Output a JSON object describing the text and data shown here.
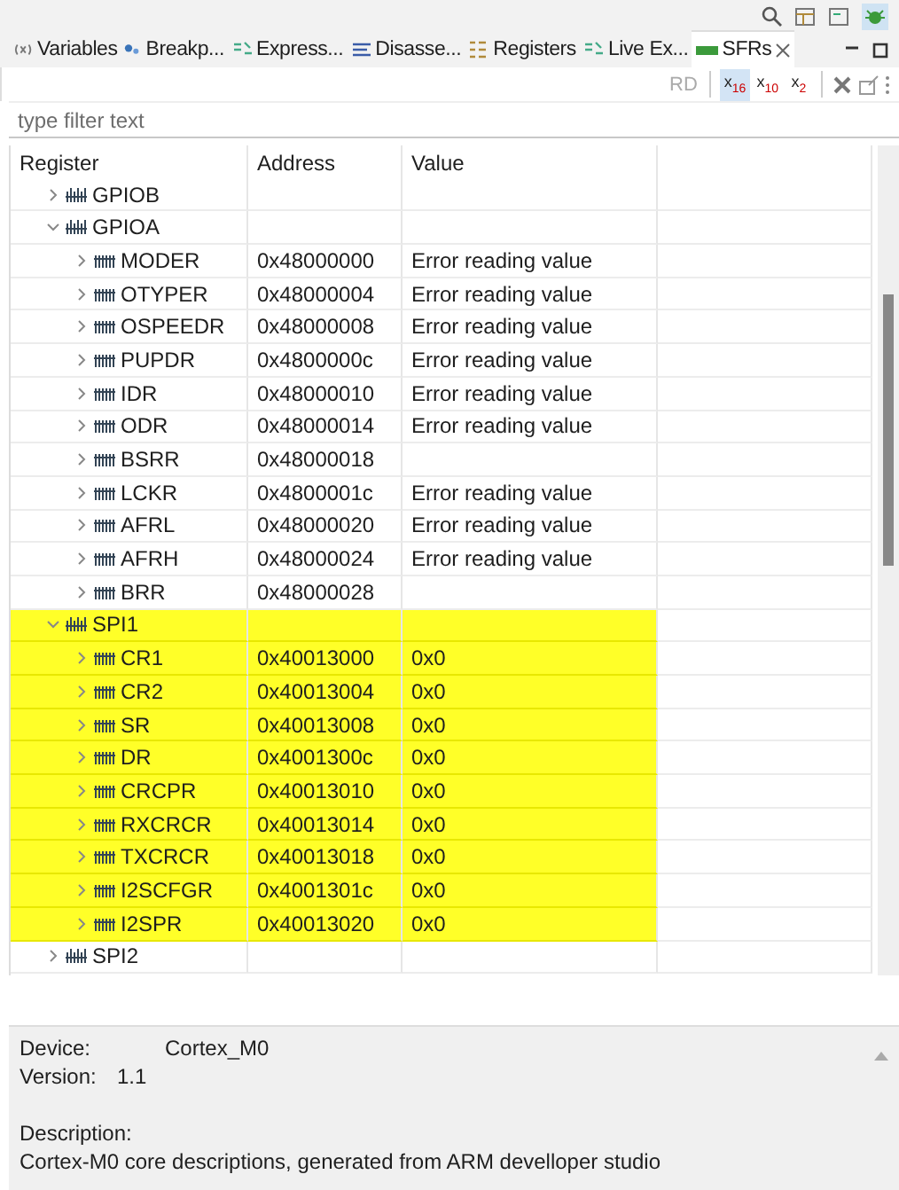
{
  "tabs": [
    {
      "label": "Variables",
      "selected": false
    },
    {
      "label": "Breakp...",
      "selected": false
    },
    {
      "label": "Express...",
      "selected": false
    },
    {
      "label": "Disasse...",
      "selected": false
    },
    {
      "label": "Registers",
      "selected": false
    },
    {
      "label": "Live Ex...",
      "selected": false
    },
    {
      "label": "SFRs",
      "selected": true
    }
  ],
  "toolbar": [
    {
      "kind": "text",
      "label": "RD",
      "disabled": true,
      "selected": false
    },
    {
      "kind": "format",
      "label": "x$_{16}$",
      "disabled": false,
      "selected": true
    },
    {
      "kind": "format",
      "label": "x$_{10}$",
      "disabled": false,
      "selected": false
    },
    {
      "kind": "format",
      "label": "x$_{2}$",
      "disabled": false,
      "selected": false
    }
  ],
  "filter": {
    "placeholder": "type filter text"
  },
  "table": {
    "columns": [
      "Register",
      "Address",
      "Value"
    ],
    "rows": [
      {
        "kind": "peripheral",
        "name": "GPIOB",
        "expanded": false,
        "highlighted": false
      },
      {
        "kind": "peripheral",
        "name": "GPIOA",
        "expanded": true,
        "highlighted": false,
        "children": [
          {
            "kind": "register",
            "name": "MODER",
            "address": "0x48000000",
            "value": "Error reading value",
            "expanded": false,
            "highlighted": false
          },
          {
            "kind": "register",
            "name": "OTYPER",
            "address": "0x48000004",
            "value": "Error reading value",
            "expanded": false,
            "highlighted": false
          },
          {
            "kind": "register",
            "name": "OSPEEDR",
            "address": "0x48000008",
            "value": "Error reading value",
            "expanded": false,
            "highlighted": false
          },
          {
            "kind": "register",
            "name": "PUPDR",
            "address": "0x4800000c",
            "value": "Error reading value",
            "expanded": false,
            "highlighted": false
          },
          {
            "kind": "register",
            "name": "IDR",
            "address": "0x48000010",
            "value": "Error reading value",
            "expanded": false,
            "highlighted": false
          },
          {
            "kind": "register",
            "name": "ODR",
            "address": "0x48000014",
            "value": "Error reading value",
            "expanded": false,
            "highlighted": false
          },
          {
            "kind": "register",
            "name": "BSRR",
            "address": "0x48000018",
            "expanded": false,
            "highlighted": false
          },
          {
            "kind": "register",
            "name": "LCKR",
            "address": "0x4800001c",
            "value": "Error reading value",
            "expanded": false,
            "highlighted": false
          },
          {
            "kind": "register",
            "name": "AFRL",
            "address": "0x48000020",
            "value": "Error reading value",
            "expanded": false,
            "highlighted": false
          },
          {
            "kind": "register",
            "name": "AFRH",
            "address": "0x48000024",
            "value": "Error reading value",
            "expanded": false,
            "highlighted": false
          },
          {
            "kind": "register",
            "name": "BRR",
            "address": "0x48000028",
            "expanded": false,
            "highlighted": false
          }
        ]
      },
      {
        "kind": "peripheral",
        "name": "SPI1",
        "expanded": true,
        "highlighted": true,
        "children": [
          {
            "kind": "register",
            "name": "CR1",
            "address": "0x40013000",
            "value": "0x0",
            "expanded": false,
            "highlighted": true
          },
          {
            "kind": "register",
            "name": "CR2",
            "address": "0x40013004",
            "value": "0x0",
            "expanded": false,
            "highlighted": true
          },
          {
            "kind": "register",
            "name": "SR",
            "address": "0x40013008",
            "value": "0x0",
            "expanded": false,
            "highlighted": true
          },
          {
            "kind": "register",
            "name": "DR",
            "address": "0x4001300c",
            "value": "0x0",
            "expanded": false,
            "highlighted": true
          },
          {
            "kind": "register",
            "name": "CRCPR",
            "address": "0x40013010",
            "value": "0x0",
            "expanded": false,
            "highlighted": true
          },
          {
            "kind": "register",
            "name": "RXCRCR",
            "address": "0x40013014",
            "value": "0x0",
            "expanded": false,
            "highlighted": true
          },
          {
            "kind": "register",
            "name": "TXCRCR",
            "address": "0x40013018",
            "value": "0x0",
            "expanded": false,
            "highlighted": true
          },
          {
            "kind": "register",
            "name": "I2SCFGR",
            "address": "0x4001301c",
            "value": "0x0",
            "expanded": false,
            "highlighted": true
          },
          {
            "kind": "register",
            "name": "I2SPR",
            "address": "0x40013020",
            "value": "0x0",
            "expanded": false,
            "highlighted": true
          }
        ]
      },
      {
        "kind": "peripheral",
        "name": "SPI2",
        "expanded": false,
        "highlighted": false
      }
    ]
  },
  "details": {
    "device_label": "Device:",
    "device": "Cortex_M0",
    "version_label": "Version:",
    "version": "1.1",
    "description_label": "Description:",
    "description": "Cortex-M0 core descriptions, generated from ARM develloper studio"
  }
}
